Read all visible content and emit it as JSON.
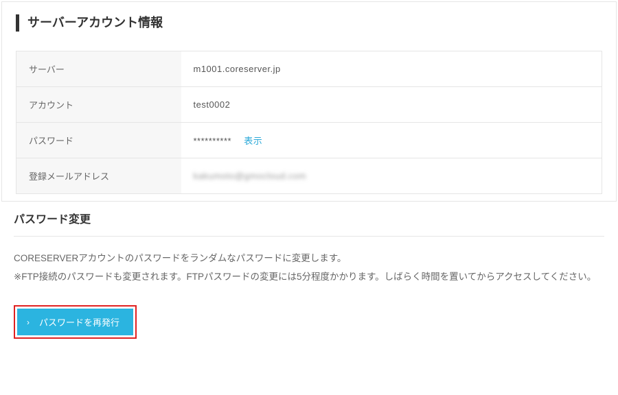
{
  "panel": {
    "title": "サーバーアカウント情報",
    "rows": {
      "server": {
        "label": "サーバー",
        "value": "m1001.coreserver.jp"
      },
      "account": {
        "label": "アカウント",
        "value": "test0002"
      },
      "password": {
        "label": "パスワード",
        "value": "**********",
        "show_label": "表示"
      },
      "email": {
        "label": "登録メールアドレス",
        "value": "kakumoto@gmocloud.com"
      }
    }
  },
  "password_change": {
    "title": "パスワード変更",
    "desc_line1": "CORESERVERアカウントのパスワードをランダムなパスワードに変更します。",
    "desc_line2": "※FTP接続のパスワードも変更されます。FTPパスワードの変更には5分程度かかります。しばらく時間を置いてからアクセスしてください。",
    "button_label": "パスワードを再発行"
  }
}
